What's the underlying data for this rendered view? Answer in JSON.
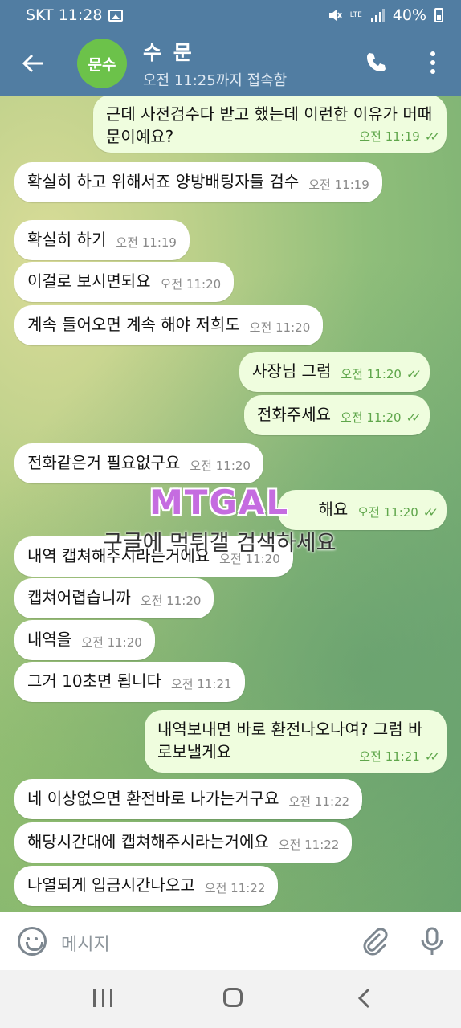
{
  "status_bar": {
    "carrier_time": "SKT 11:28",
    "network": "LTE",
    "battery": "40%"
  },
  "header": {
    "avatar_text": "문수",
    "title": "수 문",
    "subtitle": "오전 11:25까지 접속함"
  },
  "messages": [
    {
      "text": "근데 사전검수다 받고 했는데 이런한 이유가 머때문이예요?",
      "time": "오전 11:19",
      "direction": "out"
    },
    {
      "text": "확실히 하고 위해서죠 양방배팅자들 검수",
      "time": "오전 11:19",
      "direction": "in"
    },
    {
      "text": "확실히 하기",
      "time": "오전 11:19",
      "direction": "in"
    },
    {
      "text": "이걸로 보시면되요",
      "time": "오전 11:20",
      "direction": "in"
    },
    {
      "text": "계속 들어오면 계속 해야 저희도",
      "time": "오전 11:20",
      "direction": "in"
    },
    {
      "text": "사장님 그럼",
      "time": "오전 11:20",
      "direction": "out"
    },
    {
      "text": "전화주세요",
      "time": "오전 11:20",
      "direction": "out"
    },
    {
      "text": "전화같은거 필요없구요",
      "time": "오전 11:20",
      "direction": "in"
    },
    {
      "text": "해요",
      "time": "오전 11:20",
      "direction": "out"
    },
    {
      "text": "내역 캡쳐해주시라는거에요",
      "time": "오전 11:20",
      "direction": "in"
    },
    {
      "text": "캡쳐어렵습니까",
      "time": "오전 11:20",
      "direction": "in"
    },
    {
      "text": "내역을",
      "time": "오전 11:20",
      "direction": "in"
    },
    {
      "text": "그거 10초면 됩니다",
      "time": "오전 11:21",
      "direction": "in"
    },
    {
      "text": "내역보내면 바로 환전나오나여? 그럼 바로보낼게요",
      "time": "오전 11:21",
      "direction": "out"
    },
    {
      "text": "네 이상없으면 환전바로 나가는거구요",
      "time": "오전 11:22",
      "direction": "in"
    },
    {
      "text": "해당시간대에 캡쳐해주시라는거에요",
      "time": "오전 11:22",
      "direction": "in"
    },
    {
      "text": "나열되게 입금시간나오고",
      "time": "오전 11:22",
      "direction": "in"
    }
  ],
  "watermark": {
    "logo": "MTGAL",
    "text": "구글에 먹튀갤 검색하세요"
  },
  "input": {
    "placeholder": "메시지"
  },
  "icons": {
    "back": "back-arrow-icon",
    "call": "phone-icon",
    "menu": "more-vert-icon",
    "emoji": "emoji-icon",
    "attach": "paperclip-icon",
    "mic": "microphone-icon"
  },
  "colors": {
    "header_bg": "#517da2",
    "outgoing_bubble": "#effdde",
    "incoming_bubble": "#ffffff",
    "avatar": "#6cc24a"
  }
}
